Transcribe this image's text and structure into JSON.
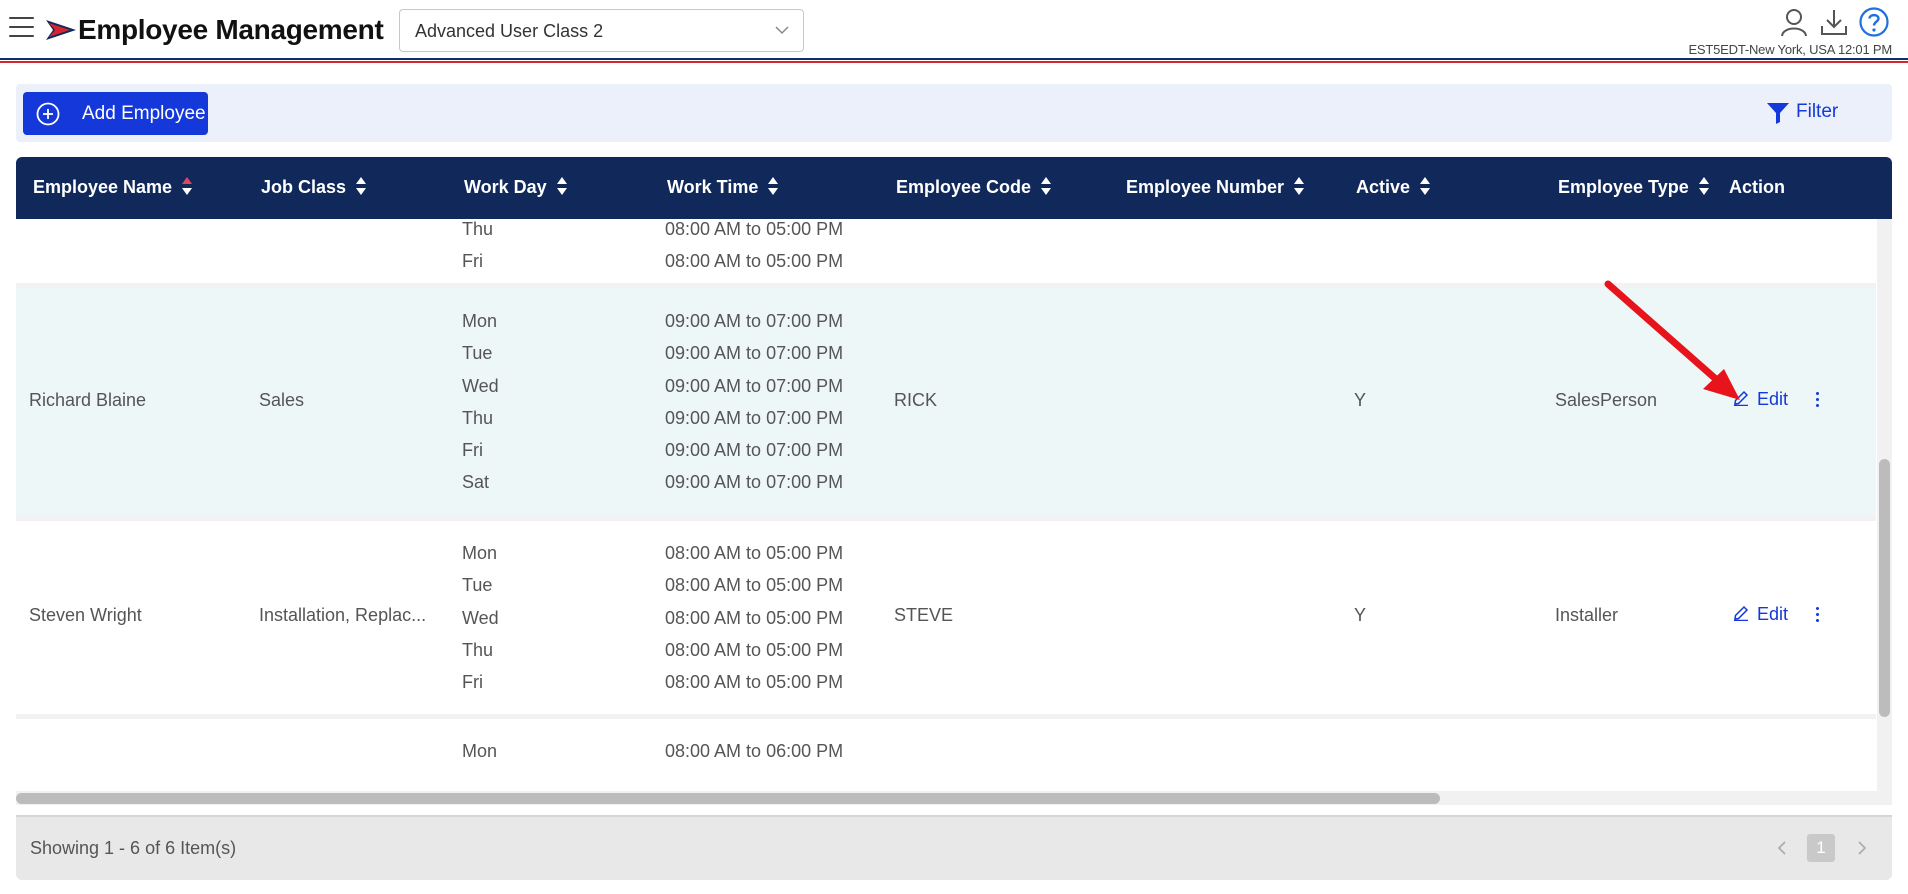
{
  "header": {
    "title": "Employee Management",
    "user_class": "Advanced User Class 2",
    "timezone_time": "EST5EDT-New York, USA 12:01 PM",
    "icons": [
      "menu-icon",
      "user-icon",
      "download-icon",
      "help-icon"
    ]
  },
  "toolbar": {
    "add_label": "Add Employee",
    "filter_label": "Filter"
  },
  "table": {
    "columns": [
      "Employee Name",
      "Job Class",
      "Work Day",
      "Work Time",
      "Employee Code",
      "Employee Number",
      "Active",
      "Employee Type",
      "Action"
    ],
    "rows": [
      {
        "name": "",
        "job_class": "",
        "days": [
          "Thu",
          "Fri"
        ],
        "times": [
          "08:00 AM to 05:00 PM",
          "08:00 AM to 05:00 PM"
        ],
        "code": "",
        "number": "",
        "active": "",
        "type": ""
      },
      {
        "name": "Richard Blaine",
        "job_class": "Sales",
        "days": [
          "Mon",
          "Tue",
          "Wed",
          "Thu",
          "Fri",
          "Sat"
        ],
        "times": [
          "09:00 AM to 07:00 PM",
          "09:00 AM to 07:00 PM",
          "09:00 AM to 07:00 PM",
          "09:00 AM to 07:00 PM",
          "09:00 AM to 07:00 PM",
          "09:00 AM to 07:00 PM"
        ],
        "code": "RICK",
        "number": "",
        "active": "Y",
        "type": "SalesPerson",
        "edit_label": "Edit"
      },
      {
        "name": "Steven Wright",
        "job_class": "Installation, Replac...",
        "days": [
          "Mon",
          "Tue",
          "Wed",
          "Thu",
          "Fri"
        ],
        "times": [
          "08:00 AM to 05:00 PM",
          "08:00 AM to 05:00 PM",
          "08:00 AM to 05:00 PM",
          "08:00 AM to 05:00 PM",
          "08:00 AM to 05:00 PM"
        ],
        "code": "STEVE",
        "number": "",
        "active": "Y",
        "type": "Installer",
        "edit_label": "Edit"
      },
      {
        "name": "",
        "job_class": "",
        "days": [
          "Mon"
        ],
        "times": [
          "08:00 AM to 06:00 PM"
        ],
        "code": "",
        "number": "",
        "active": "",
        "type": ""
      }
    ]
  },
  "pager": {
    "info": "Showing 1 - 6 of 6 Item(s)",
    "current_page": "1"
  },
  "colors": {
    "header_bg": "#10295a",
    "primary": "#1438d9",
    "highlight_row": "#eef7f8",
    "annotation_arrow": "#e8141c"
  }
}
